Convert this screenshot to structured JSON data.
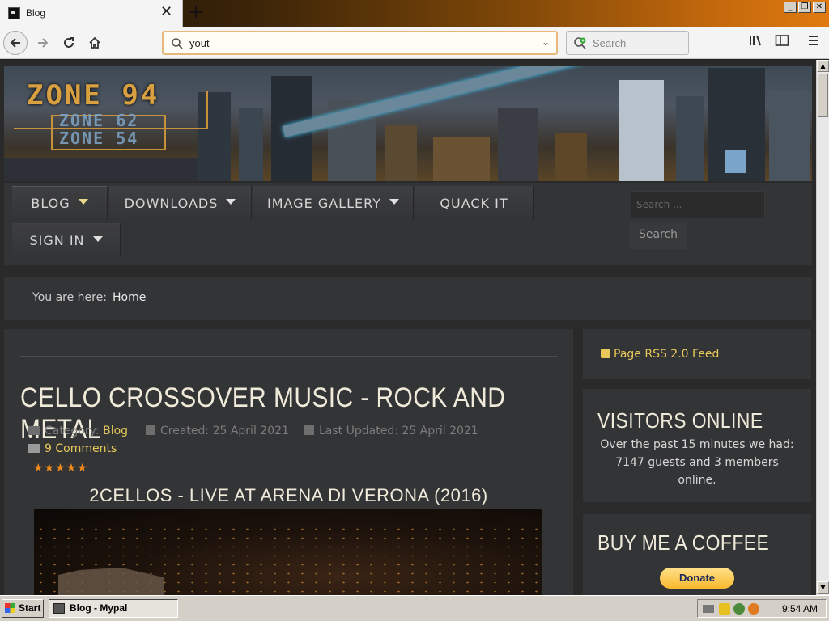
{
  "browser": {
    "tab_title": "Blog",
    "url_text": "yout",
    "search_placeholder": "Search"
  },
  "site": {
    "logo_primary": "ZONE 94",
    "logo_secondary_1": "ZONE 62",
    "logo_secondary_2": "ZONE 54",
    "menu": [
      {
        "label": "BLOG",
        "has_caret": true,
        "active": true
      },
      {
        "label": "DOWNLOADS",
        "has_caret": true
      },
      {
        "label": "IMAGE GALLERY",
        "has_caret": true
      },
      {
        "label": "QUACK IT",
        "has_caret": false
      },
      {
        "label": "SIGN IN",
        "has_caret": true
      }
    ],
    "search_placeholder": "Search ...",
    "search_button": "Search",
    "breadcrumb_label": "You are here:",
    "breadcrumb_home": "Home"
  },
  "article": {
    "title": "CELLO CROSSOVER MUSIC - ROCK AND METAL",
    "category_label": "Category:",
    "category_value": "Blog",
    "created": "Created: 25 April 2021",
    "updated": "Last Updated: 25 April 2021",
    "comments": "9 Comments",
    "stars": "★★★★★",
    "subtitle": "2CELLOS - LIVE AT ARENA DI VERONA (2016)"
  },
  "sidebar": {
    "rss": "Page RSS 2.0 Feed",
    "visitors_title": "VISITORS ONLINE",
    "visitors_line1": "Over the past 15 minutes we had:",
    "visitors_line2": "7147 guests and 3 members",
    "visitors_line3": "online.",
    "coffee_title": "BUY ME A COFFEE",
    "donate_label": "Donate"
  },
  "taskbar": {
    "start_label": "Start",
    "task_label": "Blog - Mypal",
    "clock": "9:54 AM"
  },
  "colors": {
    "accent_gold": "#e8c85a",
    "panel": "#333436",
    "page_bg": "#2a2a2b",
    "stars": "#f08a1a"
  }
}
